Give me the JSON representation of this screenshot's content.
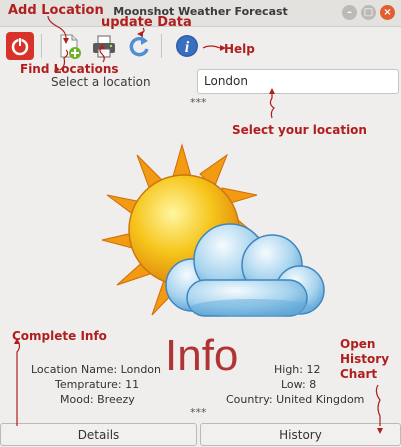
{
  "window": {
    "title": "Moonshot Weather Forecast"
  },
  "toolbar": {
    "power_icon": "power-icon",
    "add_location_icon": "add-location-icon",
    "find_locations_icon": "printer-icon",
    "update_icon": "refresh-icon",
    "help_icon": "info-icon"
  },
  "location": {
    "label": "Select a location",
    "selected": "London",
    "separator": "***"
  },
  "annotations": {
    "add_location": "Add Location",
    "update_data": "update Data",
    "find_locations": "Find Locations",
    "help": "Help",
    "select_location": "Select your location",
    "complete_info": "Complete Info",
    "open_history": "Open\nHistory\nChart"
  },
  "info": {
    "heading": "Info",
    "location_name": "Location Name: London",
    "temperature": "Temprature: 11",
    "mood": "Mood: Breezy",
    "high": "High: 12",
    "low": "Low: 8",
    "country": "Country: United Kingdom",
    "separator": "***"
  },
  "buttons": {
    "details": "Details",
    "history": "History"
  },
  "colors": {
    "annotation": "#b01e1e",
    "info_heading": "#b03434",
    "close_button": "#e15f2f"
  }
}
